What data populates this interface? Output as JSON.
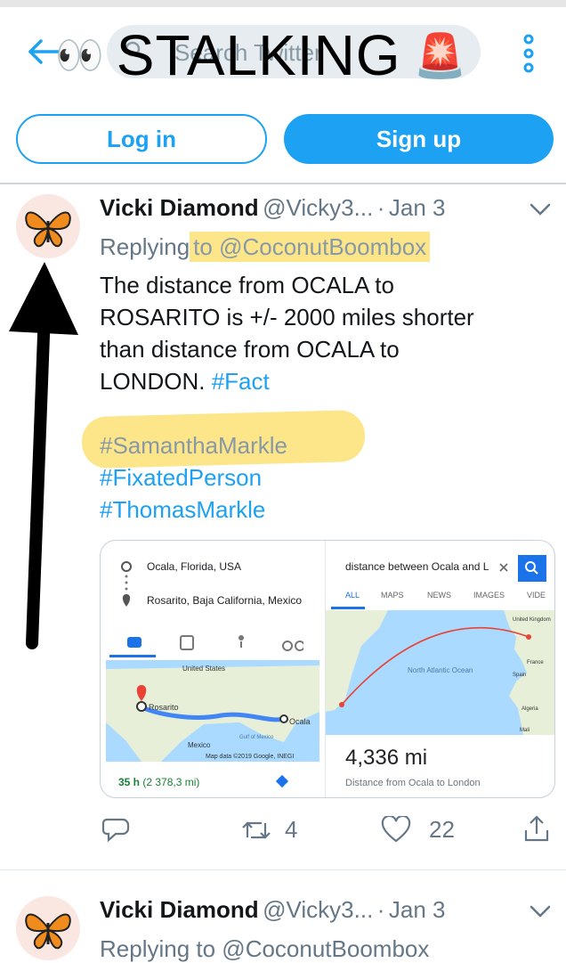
{
  "header": {
    "back_icon": "back-arrow-icon",
    "search_placeholder": "Search Twitter",
    "sticker_text": "STALKING",
    "eyes_emoji": "👀",
    "siren_emoji": "🚨",
    "menu_icon": "kebab-menu-icon"
  },
  "auth": {
    "login_label": "Log in",
    "signup_label": "Sign up"
  },
  "colors": {
    "accent": "#1da1f2",
    "highlight": "#fde68a",
    "muted": "#657786"
  },
  "tweets": [
    {
      "name": "Vicki Diamond",
      "handle": "@Vicky3...",
      "dot": "·",
      "date": "Jan 3",
      "replying_prefix": "Replying",
      "replying_target": "to @CoconutBoombox",
      "body_lines": [
        "The distance  from OCALA to",
        "ROSARITO  is +/- 2000 miles shorter",
        "than distance from   OCALA to",
        "LONDON. "
      ],
      "inline_tag": "#Fact",
      "hashtags": [
        "#SamanthaMarkle",
        "#FixatedPerson",
        "#ThomasMarkle"
      ],
      "actions": {
        "retweets": "4",
        "likes": "22"
      }
    },
    {
      "name": "Vicki Diamond",
      "handle": "@Vicky3...",
      "dot": "·",
      "date": "Jan 3",
      "replying_partial": "Replying to @CoconutBoombox"
    }
  ],
  "media": {
    "left": {
      "origin": "Ocala, Florida, USA",
      "destination": "Rosarito, Baja California, Mexico",
      "map_labels": [
        "United States",
        "Rosarito",
        "Ocala",
        "Mexico",
        "Gulf of Mexico"
      ],
      "map_credit": "Map data ©2019 Google, INEGI",
      "duration_bold": "35 h",
      "duration_rest": "(2 378,3 mi)"
    },
    "right": {
      "query": "distance between Ocala and L",
      "tabs": [
        "ALL",
        "MAPS",
        "NEWS",
        "IMAGES",
        "VIDE"
      ],
      "map_labels": [
        "United Kingdom",
        "France",
        "Spain",
        "North Atlantic Ocean",
        "Algeria",
        "Mali"
      ],
      "distance": "4,336 mi",
      "caption": "Distance from Ocala to London"
    }
  }
}
